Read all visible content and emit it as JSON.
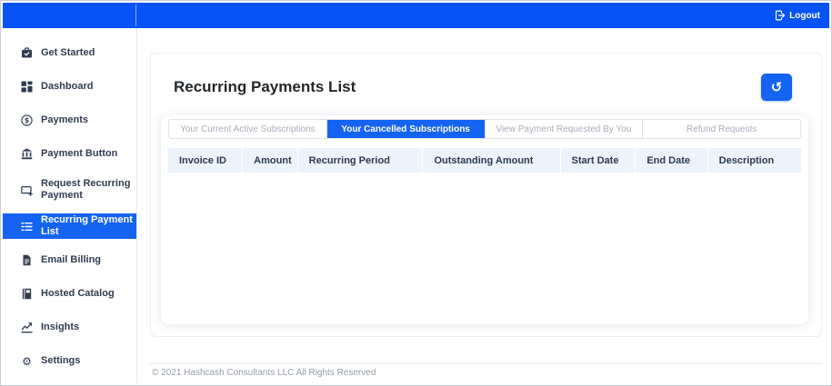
{
  "topbar": {
    "logout_label": "Logout",
    "logout_icon": "logout-icon"
  },
  "sidebar": {
    "items": [
      {
        "label": "Get Started",
        "icon": "briefcase-check-icon",
        "active": false
      },
      {
        "label": "Dashboard",
        "icon": "grid-icon",
        "active": false
      },
      {
        "label": "Payments",
        "icon": "dollar-circle-icon",
        "active": false
      },
      {
        "label": "Payment Button",
        "icon": "bank-icon",
        "active": false
      },
      {
        "label": "Request Recurring Payment",
        "icon": "card-plus-icon",
        "active": false
      },
      {
        "label": "Recurring Payment List",
        "icon": "list-icon",
        "active": true
      },
      {
        "label": "Email Billing",
        "icon": "document-icon",
        "active": false
      },
      {
        "label": "Hosted Catalog",
        "icon": "book-icon",
        "active": false
      },
      {
        "label": "Insights",
        "icon": "chart-icon",
        "active": false
      },
      {
        "label": "Settings",
        "icon": "gear-icon",
        "active": false
      }
    ]
  },
  "main": {
    "title": "Recurring Payments List",
    "history_button_icon": "history-icon",
    "tabs": [
      {
        "label": "Your Current Active Subscriptions",
        "active": false
      },
      {
        "label": "Your Cancelled Subscriptions",
        "active": true
      },
      {
        "label": "View Payment Requested By You",
        "active": false
      },
      {
        "label": "Refund Requests",
        "active": false
      }
    ],
    "table": {
      "columns": [
        "Invoice ID",
        "Amount",
        "Recurring Period",
        "Outstanding Amount",
        "Start Date",
        "End Date",
        "Description"
      ],
      "rows": []
    }
  },
  "footer": {
    "copyright": "© 2021 Hashcash Consultants LLC All Rights Reserved"
  },
  "colors": {
    "topbar_blue": "#0753f6",
    "accent_blue": "#1463f1",
    "table_header_bg": "#ecf3fb",
    "sidebar_text": "#303c52"
  }
}
